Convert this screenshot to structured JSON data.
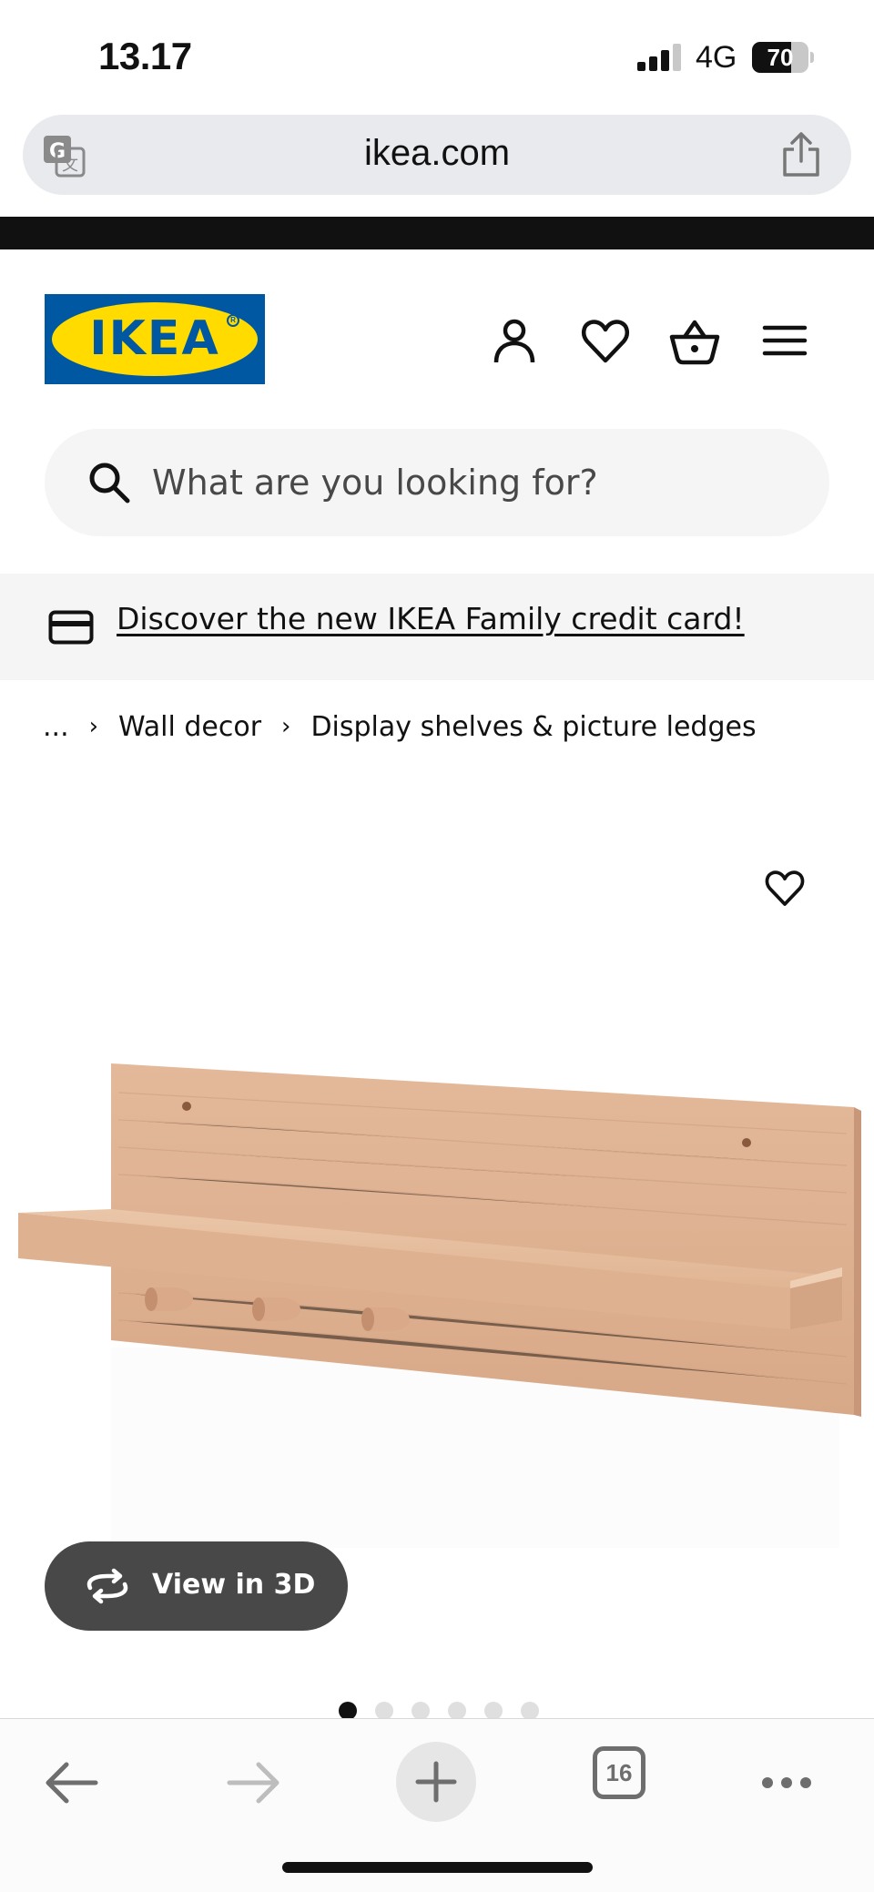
{
  "status_bar": {
    "time": "13.17",
    "network": "4G",
    "battery_percent": "70",
    "battery_level": 0.7,
    "signal_bars_filled": 3
  },
  "browser": {
    "url": "ikea.com",
    "translate_icon": "translate-icon",
    "share_icon": "share-icon"
  },
  "header": {
    "logo_text": "IKEA",
    "logo_colors": {
      "blue": "#0058a3",
      "yellow": "#ffdb00"
    },
    "icons": [
      "account-icon",
      "heart-icon",
      "basket-icon",
      "menu-icon"
    ]
  },
  "search": {
    "placeholder": "What are you looking for?"
  },
  "banner": {
    "text": "Discover the new IKEA Family credit card!"
  },
  "breadcrumb": {
    "ellipsis": "...",
    "items": [
      "Wall decor",
      "Display shelves & picture ledges"
    ]
  },
  "product": {
    "view_3d_label": "View in 3D",
    "image_count": 6,
    "active_image_index": 0
  },
  "toolbar": {
    "tab_count": "16"
  }
}
